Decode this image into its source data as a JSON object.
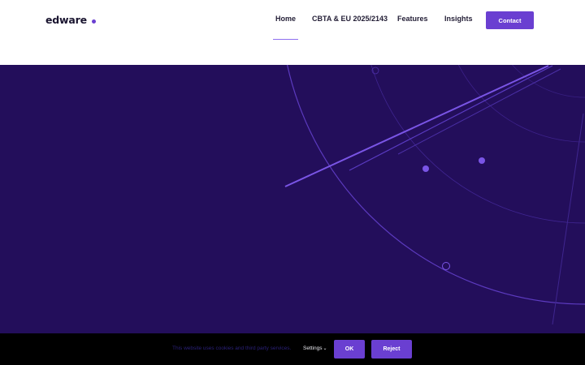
{
  "header": {
    "logo_text": "edware",
    "nav": [
      {
        "label": "Home",
        "active": true
      },
      {
        "label": "CBTA & EU 2025/2143",
        "active": false
      },
      {
        "label": "Features",
        "active": false
      },
      {
        "label": "Insights",
        "active": false
      }
    ],
    "contact_label": "Contact"
  },
  "colors": {
    "brand": "#6a3fd1",
    "hero_background": "#230e5b",
    "cookie_bar": "#000000"
  },
  "cookie_banner": {
    "text": "This website uses cookies and third party services.",
    "settings_label": "Settings",
    "ok_label": "OK",
    "reject_label": "Reject"
  }
}
